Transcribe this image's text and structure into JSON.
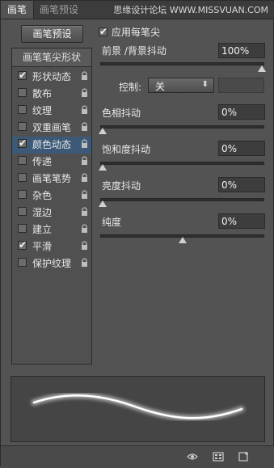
{
  "tabs": [
    {
      "label": "画笔"
    },
    {
      "label": "画笔预设"
    }
  ],
  "watermark": "思缘设计论坛 WWW.MISSVUAN.COM",
  "preset_button": "画笔预设",
  "left_panel": {
    "title": "画笔笔尖形状",
    "items": [
      {
        "label": "形状动态",
        "checked": true,
        "selected": false
      },
      {
        "label": "散布",
        "checked": false,
        "selected": false
      },
      {
        "label": "纹理",
        "checked": false,
        "selected": false
      },
      {
        "label": "双重画笔",
        "checked": false,
        "selected": false
      },
      {
        "label": "颜色动态",
        "checked": true,
        "selected": true
      },
      {
        "label": "传递",
        "checked": false,
        "selected": false
      },
      {
        "label": "画笔笔势",
        "checked": false,
        "selected": false
      },
      {
        "label": "杂色",
        "checked": false,
        "selected": false
      },
      {
        "label": "湿边",
        "checked": false,
        "selected": false
      },
      {
        "label": "建立",
        "checked": false,
        "selected": false
      },
      {
        "label": "平滑",
        "checked": true,
        "selected": false
      },
      {
        "label": "保护纹理",
        "checked": false,
        "selected": false
      }
    ]
  },
  "apply_per_tip": {
    "label": "应用每笔尖",
    "checked": true
  },
  "params": {
    "fg_bg_jitter": {
      "label": "前景 /背景抖动",
      "value": "100%",
      "level": 1.0
    },
    "control": {
      "label": "控制:",
      "value": "关"
    },
    "hue_jitter": {
      "label": "色相抖动",
      "value": "0%",
      "level": 0.0
    },
    "saturation_jitter": {
      "label": "饱和度抖动",
      "value": "0%",
      "level": 0.0
    },
    "brightness_jitter": {
      "label": "亮度抖动",
      "value": "0%",
      "level": 0.0
    },
    "purity": {
      "label": "纯度",
      "value": "0%",
      "level": 0.5
    }
  },
  "colors": {
    "panel": "#535353",
    "selected": "#3c5a78",
    "stroke": "#ffffff"
  }
}
